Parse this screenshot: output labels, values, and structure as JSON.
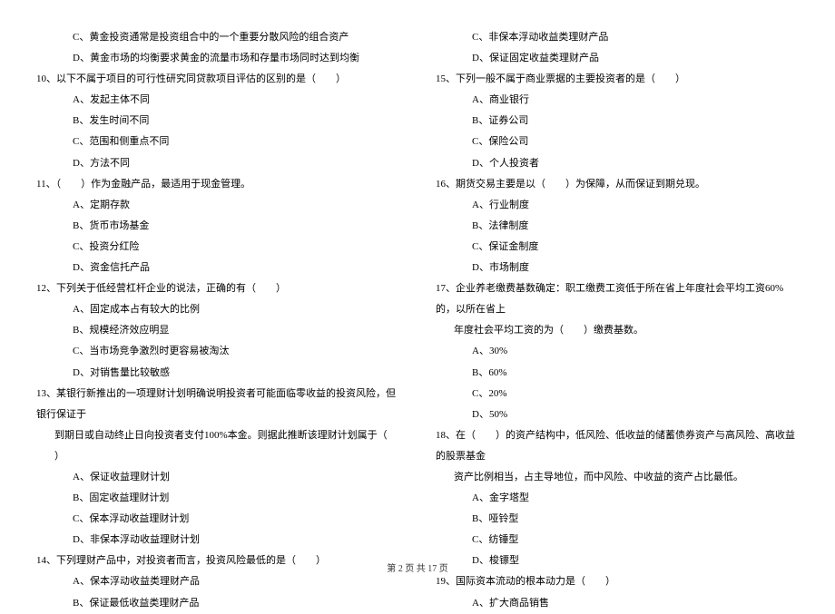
{
  "left": {
    "pre_opts": [
      "C、黄金投资通常是投资组合中的一个重要分散风险的组合资产",
      "D、黄金市场的均衡要求黄金的流量市场和存量市场同时达到均衡"
    ],
    "q10": {
      "stem": "10、以下不属于项目的可行性研究同贷款项目评估的区别的是（　　）",
      "opts": [
        "A、发起主体不同",
        "B、发生时间不同",
        "C、范围和侧重点不同",
        "D、方法不同"
      ]
    },
    "q11": {
      "stem": "11、（　　）作为金融产品，最适用于现金管理。",
      "opts": [
        "A、定期存款",
        "B、货币市场基金",
        "C、投资分红险",
        "D、资金信托产品"
      ]
    },
    "q12": {
      "stem": "12、下列关于低经营杠杆企业的说法，正确的有（　　）",
      "opts": [
        "A、固定成本占有较大的比例",
        "B、规模经济效应明显",
        "C、当市场竞争激烈时更容易被淘汰",
        "D、对销售量比较敏感"
      ]
    },
    "q13": {
      "stem1": "13、某银行新推出的一项理财计划明确说明投资者可能面临零收益的投资风险，但银行保证于",
      "stem2": "到期日或自动终止日向投资者支付100%本金。则据此推断该理财计划属于（　　）",
      "opts": [
        "A、保证收益理财计划",
        "B、固定收益理财计划",
        "C、保本浮动收益理财计划",
        "D、非保本浮动收益理财计划"
      ]
    },
    "q14": {
      "stem": "14、下列理财产品中，对投资者而言，投资风险最低的是（　　）",
      "opts": [
        "A、保本浮动收益类理财产品",
        "B、保证最低收益类理财产品"
      ]
    }
  },
  "right": {
    "pre_opts": [
      "C、非保本浮动收益类理财产品",
      "D、保证固定收益类理财产品"
    ],
    "q15": {
      "stem": "15、下列一般不属于商业票据的主要投资者的是（　　）",
      "opts": [
        "A、商业银行",
        "B、证券公司",
        "C、保险公司",
        "D、个人投资者"
      ]
    },
    "q16": {
      "stem": "16、期货交易主要是以（　　）为保障，从而保证到期兑现。",
      "opts": [
        "A、行业制度",
        "B、法律制度",
        "C、保证金制度",
        "D、市场制度"
      ]
    },
    "q17": {
      "stem1": "17、企业养老缴费基数确定：职工缴费工资低于所在省上年度社会平均工资60%的，以所在省上",
      "stem2": "年度社会平均工资的为（　　）缴费基数。",
      "opts": [
        "A、30%",
        "B、60%",
        "C、20%",
        "D、50%"
      ]
    },
    "q18": {
      "stem1": "18、在（　　）的资产结构中，低风险、低收益的储蓄债券资产与高风险、高收益的股票基金",
      "stem2": "资产比例相当，占主导地位，而中风险、中收益的资产占比最低。",
      "opts": [
        "A、金字塔型",
        "B、哑铃型",
        "C、纺锤型",
        "D、梭镖型"
      ]
    },
    "q19": {
      "stem": "19、国际资本流动的根本动力是（　　）",
      "opts": [
        "A、扩大商品销售"
      ]
    }
  },
  "footer": "第 2 页 共 17 页"
}
